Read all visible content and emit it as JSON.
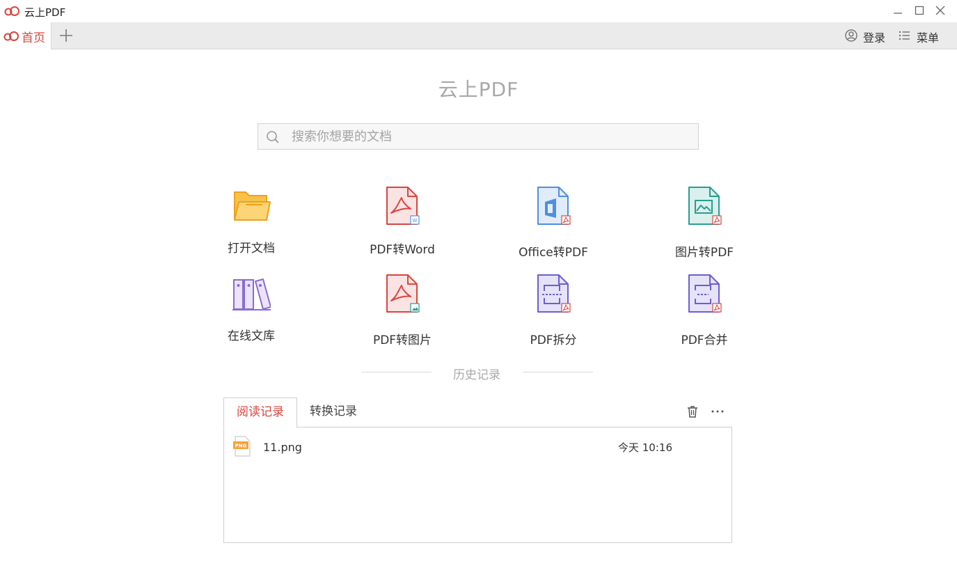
{
  "window": {
    "title": "云上PDF"
  },
  "tabbar": {
    "home_label": "首页",
    "login_label": "登录",
    "menu_label": "菜单"
  },
  "main": {
    "brand": "云上PDF",
    "search": {
      "placeholder": "搜索你想要的文档",
      "value": ""
    },
    "tools": [
      {
        "label": "打开文档",
        "icon": "folder-icon"
      },
      {
        "label": "PDF转Word",
        "icon": "pdf-to-word-icon"
      },
      {
        "label": "Office转PDF",
        "icon": "office-to-pdf-icon"
      },
      {
        "label": "图片转PDF",
        "icon": "image-to-pdf-icon"
      },
      {
        "label": "在线文库",
        "icon": "library-icon"
      },
      {
        "label": "PDF转图片",
        "icon": "pdf-to-image-icon"
      },
      {
        "label": "PDF拆分",
        "icon": "pdf-split-icon"
      },
      {
        "label": "PDF合并",
        "icon": "pdf-merge-icon"
      }
    ]
  },
  "history": {
    "title": "历史记录",
    "tabs": [
      "阅读记录",
      "转换记录"
    ],
    "active_tab": 0,
    "items": [
      {
        "name": "11.png",
        "time": "今天 10:16",
        "icon": "png-file-icon",
        "icon_text": "PNG"
      }
    ]
  },
  "colors": {
    "accent": "#d9453f",
    "muted": "#a8a8a8",
    "tabbar_bg": "#ebebeb"
  }
}
